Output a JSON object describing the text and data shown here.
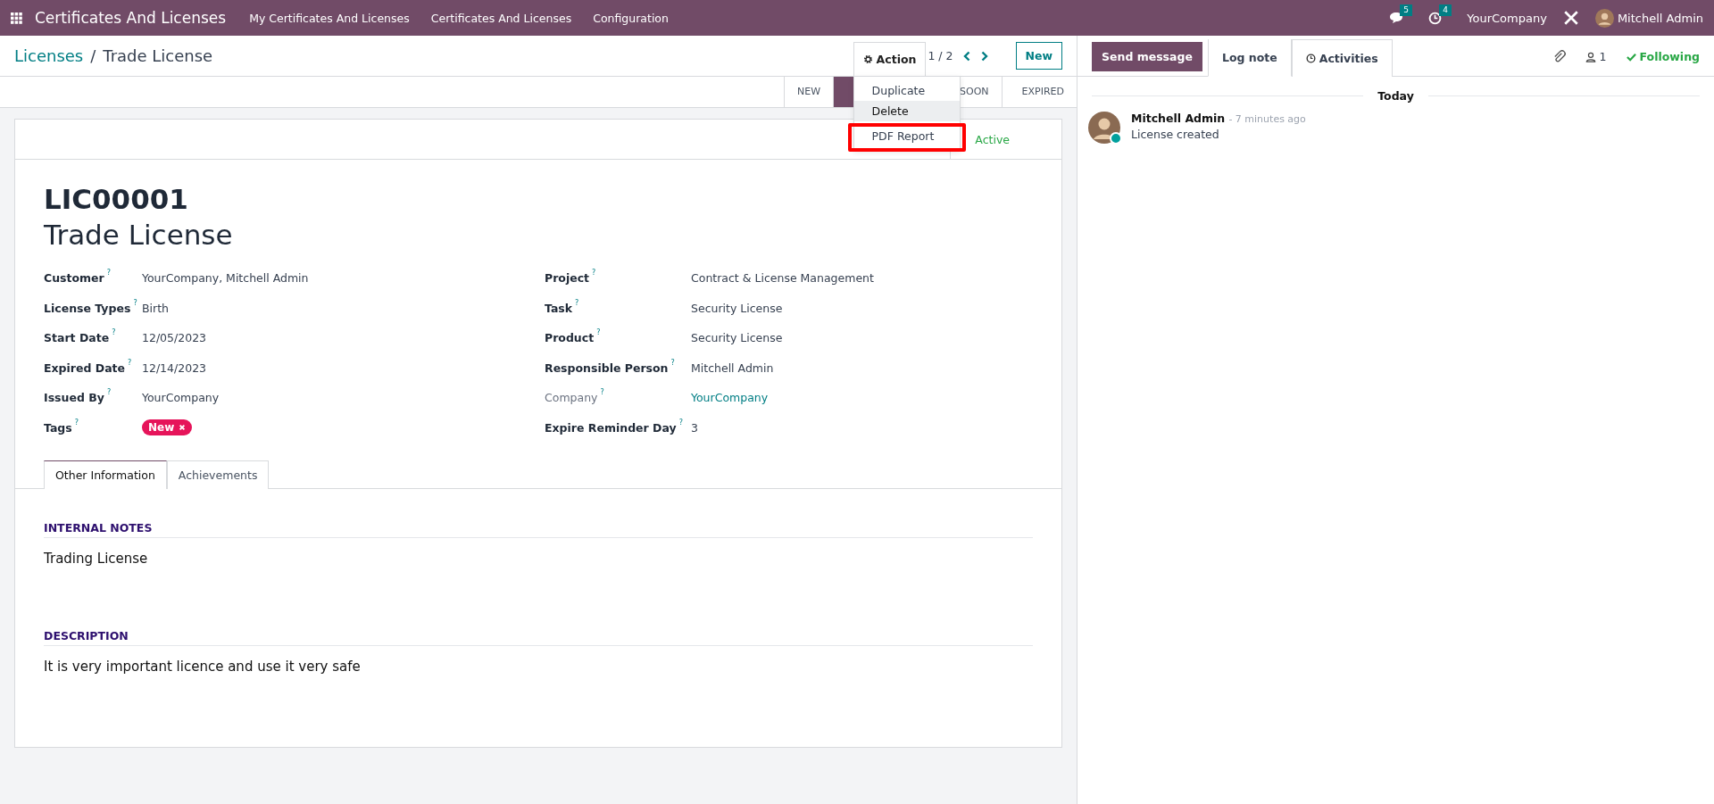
{
  "navbar": {
    "app_name": "Certificates And Licenses",
    "menus": [
      "My Certificates And Licenses",
      "Certificates And Licenses",
      "Configuration"
    ],
    "messages_count": "5",
    "activities_count": "4",
    "company": "YourCompany",
    "user": "Mitchell Admin"
  },
  "breadcrumb": {
    "parent": "Licenses",
    "separator": "/",
    "current": "Trade License"
  },
  "action_button": "Action",
  "pager": "1 / 2",
  "new_button": "New",
  "action_menu": [
    {
      "label": "Duplicate",
      "hovered": false,
      "highlighted": false
    },
    {
      "label": "Delete",
      "hovered": true,
      "highlighted": false
    },
    {
      "label": "PDF Report",
      "hovered": false,
      "highlighted": true
    }
  ],
  "stages": [
    {
      "label": "NEW",
      "selected": false
    },
    {
      "selected": true
    },
    {
      "label": "SOON",
      "selected": false
    },
    {
      "label": "EXPIRED",
      "selected": false
    }
  ],
  "status_toggle": {
    "label": "Active",
    "on": true
  },
  "record": {
    "reference": "LIC00001",
    "name": "Trade License"
  },
  "fields_left": [
    {
      "label": "Customer",
      "help": "?",
      "value": "YourCompany, Mitchell Admin",
      "kind": "text",
      "muted": false
    },
    {
      "label": "License Types",
      "help": "?",
      "value": "Birth",
      "kind": "text",
      "muted": false
    },
    {
      "label": "Start Date",
      "help": "?",
      "value": "12/05/2023",
      "kind": "text",
      "muted": false
    },
    {
      "label": "Expired Date",
      "help": "?",
      "value": "12/14/2023",
      "kind": "text",
      "muted": false
    },
    {
      "label": "Issued By",
      "help": "?",
      "value": "YourCompany",
      "kind": "text",
      "muted": false
    },
    {
      "label": "Tags",
      "help": "?",
      "value": "New",
      "kind": "tag",
      "muted": false
    }
  ],
  "fields_right": [
    {
      "label": "Project",
      "help": "?",
      "value": "Contract & License Management",
      "kind": "text",
      "muted": false
    },
    {
      "label": "Task",
      "help": "?",
      "value": "Security License",
      "kind": "text",
      "muted": false
    },
    {
      "label": "Product",
      "help": "?",
      "value": "Security License",
      "kind": "text",
      "muted": false
    },
    {
      "label": "Responsible Person",
      "help": "?",
      "value": "Mitchell Admin",
      "kind": "text",
      "muted": false
    },
    {
      "label": "Company",
      "help": "?",
      "value": "YourCompany",
      "kind": "link",
      "muted": true
    },
    {
      "label": "Expire Reminder Day",
      "help": "?",
      "value": "3",
      "kind": "text",
      "muted": false
    }
  ],
  "tabs": [
    {
      "label": "Other Information",
      "selected": true
    },
    {
      "label": "Achievements",
      "selected": false
    }
  ],
  "sections": [
    {
      "heading": "INTERNAL NOTES",
      "text": "Trading License"
    },
    {
      "heading": "DESCRIPTION",
      "text": "It is very important licence and use it very safe"
    }
  ],
  "chatter": {
    "send_message": "Send message",
    "log_note": "Log note",
    "activities": "Activities",
    "followers_count": "1",
    "following": "Following",
    "date_divider": "Today",
    "messages": [
      {
        "author": "Mitchell Admin",
        "time": "- 7 minutes ago",
        "body": "License created"
      }
    ]
  }
}
